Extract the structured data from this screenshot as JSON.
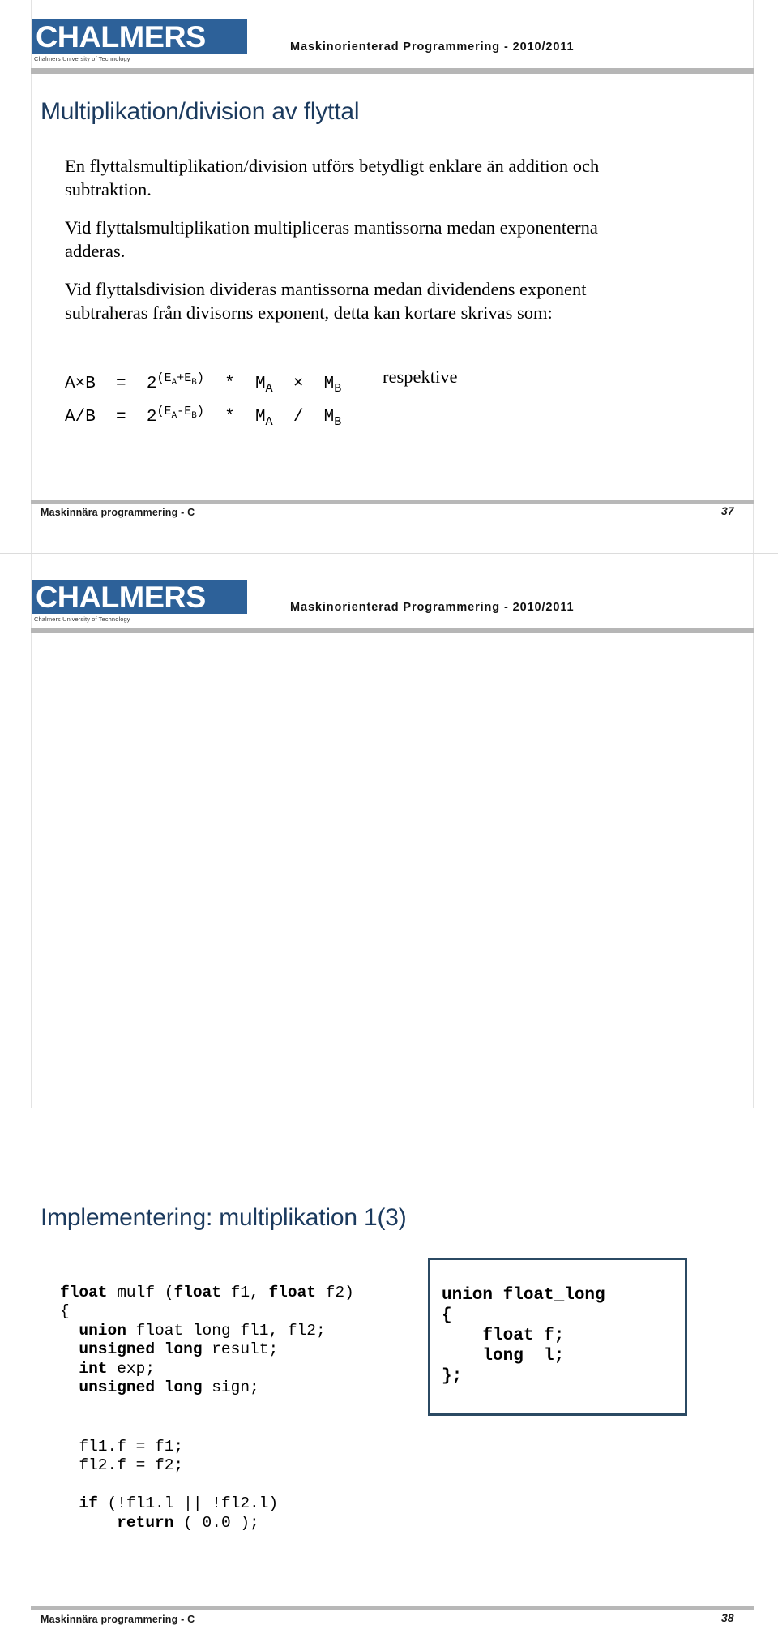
{
  "theme": {
    "logo_blue": "#2d6199",
    "title_navy": "#1b3a5e",
    "rule_grey": "#b6b6b6",
    "box_border": "#2b4a63"
  },
  "brand": {
    "logo_wordmark": "CHALMERS",
    "logo_subtitle": "Chalmers University of Technology",
    "course_header": "Maskinorienterad Programmering - 2010/2011"
  },
  "slides": [
    {
      "title": "Multiplikation/division av flyttal",
      "paragraphs": [
        "En flyttalsmultiplikation/division utförs betydligt enklare än addition och subtraktion.",
        "Vid flyttalsmultiplikation multipliceras mantissorna medan exponenterna adderas.",
        "Vid flyttalsdivision divideras mantissorna medan dividendens exponent subtraheras från divisorns exponent, detta kan kortare skrivas som:"
      ],
      "formula": {
        "line1": {
          "lhs": "A×B",
          "eq": "=",
          "base": "2",
          "exp_open": "(E",
          "exp_sub1": "A",
          "exp_op": "+E",
          "exp_sub2": "B",
          "exp_close": ")",
          "star": "*",
          "m1": "M",
          "m1_sub": "A",
          "op": "×",
          "m2": "M",
          "m2_sub": "B"
        },
        "line2": {
          "lhs": "A/B",
          "eq": "=",
          "base": "2",
          "exp_open": "(E",
          "exp_sub1": "A",
          "exp_op": "-E",
          "exp_sub2": "B",
          "exp_close": ")",
          "star": "*",
          "m1": "M",
          "m1_sub": "A",
          "op": "/",
          "m2": "M",
          "m2_sub": "B"
        },
        "note": "respektive"
      },
      "footer_left": "Maskinnära programmering - C",
      "footer_right": "37"
    },
    {
      "title": "Implementering: multiplikation 1(3)",
      "code_upper": [
        {
          "kw": "float",
          "rest": " mulf ("
        },
        {
          "kw": "float",
          "rest": " f1, "
        },
        {
          "kw": "float",
          "rest": " f2)"
        }
      ],
      "footer_left": "Maskinnära programmering - C",
      "footer_right": "38"
    }
  ],
  "code": {
    "function_block": "float mulf (float f1, float f2)\n{\n  union float_long fl1, fl2;\n  unsigned long result;\n  int exp;\n  unsigned long sign;",
    "assign_block": "  fl1.f = f1;\n  fl2.f = f2;\n\n  if (!fl1.l || !fl2.l)\n      return ( 0.0 );",
    "union_block": "union float_long\n{\n    float f;\n    long  l;\n};",
    "lines_function": [
      {
        "bold": "float",
        "plain": " mulf (",
        "bold2": "float",
        "plain2": " f1, ",
        "bold3": "float",
        "plain3": " f2)"
      },
      {
        "plain": "{"
      },
      {
        "indent": "  ",
        "bold": "union",
        "plain": " float_long fl1, fl2;"
      },
      {
        "indent": "  ",
        "bold": "unsigned long",
        "plain": " result;"
      },
      {
        "indent": "  ",
        "bold": "int",
        "plain": " exp;"
      },
      {
        "indent": "  ",
        "bold": "unsigned long",
        "plain": " sign;"
      }
    ],
    "lines_assign": [
      {
        "plain": "  fl1.f = f1;"
      },
      {
        "plain": "  fl2.f = f2;"
      },
      {
        "plain": ""
      },
      {
        "indent": "  ",
        "bold": "if",
        "plain": " (!fl1.l || !fl2.l)"
      },
      {
        "indent": "      ",
        "bold": "return",
        "plain": " ( 0.0 );"
      }
    ],
    "lines_union": [
      {
        "bold": "union float_long"
      },
      {
        "bold": "{"
      },
      {
        "bold": "    float f;"
      },
      {
        "bold": "    long  l;"
      },
      {
        "bold": "};"
      }
    ]
  }
}
